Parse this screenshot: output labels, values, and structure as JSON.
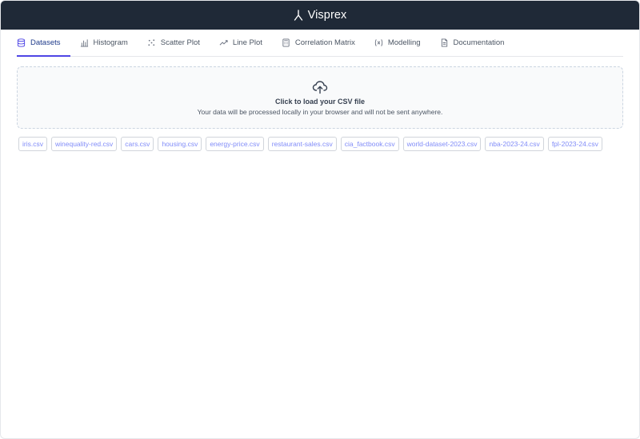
{
  "app": {
    "title": "Visprex"
  },
  "tabs": [
    {
      "label": "Datasets",
      "icon": "database-icon",
      "active": true
    },
    {
      "label": "Histogram",
      "icon": "bar-chart-icon",
      "active": false
    },
    {
      "label": "Scatter Plot",
      "icon": "scatter-icon",
      "active": false
    },
    {
      "label": "Line Plot",
      "icon": "trend-icon",
      "active": false
    },
    {
      "label": "Correlation Matrix",
      "icon": "calculator-icon",
      "active": false
    },
    {
      "label": "Modelling",
      "icon": "variable-icon",
      "active": false
    },
    {
      "label": "Documentation",
      "icon": "document-icon",
      "active": false
    }
  ],
  "dropzone": {
    "icon": "cloud-upload-icon",
    "main": "Click to load your CSV file",
    "sub": "Your data will be processed locally in your browser and will not be sent anywhere."
  },
  "datasets": [
    "iris.csv",
    "winequality-red.csv",
    "cars.csv",
    "housing.csv",
    "energy-price.csv",
    "restaurant-sales.csv",
    "cia_factbook.csv",
    "world-dataset-2023.csv",
    "nba-2023-24.csv",
    "fpl-2023-24.csv"
  ],
  "colors": {
    "header_bg": "#1f2937",
    "accent": "#4f46e5",
    "chip_text": "#818cf8"
  }
}
